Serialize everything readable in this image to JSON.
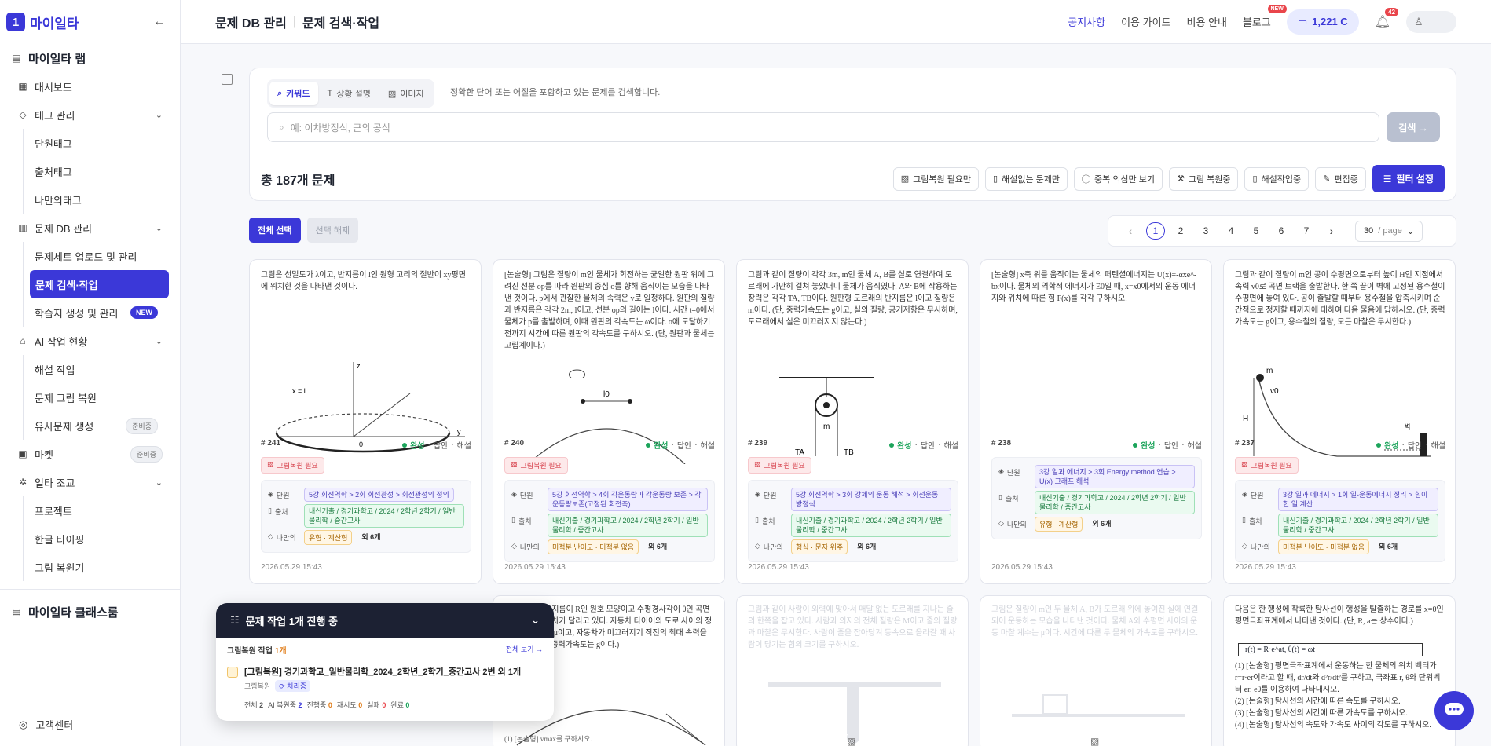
{
  "brand": {
    "logo_text": "마이일타"
  },
  "sidebar": {
    "app_section": "마이일타 랩",
    "items": [
      {
        "label": "대시보드"
      },
      {
        "label": "태그 관리"
      },
      {
        "label": "문제 DB 관리"
      },
      {
        "label": "AI 작업 현황"
      },
      {
        "label": "마켓",
        "badge": "준비중"
      },
      {
        "label": "일타 조교"
      }
    ],
    "tag_sub": [
      "단원태그",
      "출처태그",
      "나만의태그"
    ],
    "db_sub": [
      "문제세트 업로드 및 관리",
      "문제 검색·작업",
      "학습지 생성 및 관리"
    ],
    "db_sub_badge": "NEW",
    "ai_sub": [
      "해설 작업",
      "문제 그림 복원",
      "유사문제 생성"
    ],
    "ai_sub_badge": "준비중",
    "tutor_sub": [
      "프로젝트",
      "한글 타이핑",
      "그림 복원기"
    ],
    "classroom": "마이일타 클래스룸",
    "support": "고객센터"
  },
  "header": {
    "crumb1": "문제 DB 관리",
    "crumb2": "문제 검색·작업",
    "nav": [
      "공지사항",
      "이용 가이드",
      "비용 안내",
      "블로그"
    ],
    "blog_badge": "NEW",
    "credit": "1,221 C",
    "notif_count": "42"
  },
  "search": {
    "tabs": [
      "키워드",
      "상황 설명",
      "이미지"
    ],
    "help": "정확한 단어 또는 어절을 포함하고 있는 문제를 검색합니다.",
    "placeholder": "예: 이차방정식, 근의 공식",
    "button": "검색 →"
  },
  "filters": {
    "total": "총 187개 문제",
    "chips": [
      "그림복원 필요만",
      "해설없는 문제만",
      "중복 의심만 보기",
      "그림 복원중",
      "해설작업중",
      "편집중"
    ],
    "filter_button": "필터 설정"
  },
  "selection": {
    "select_all": "전체 선택",
    "clear": "선택 해제"
  },
  "pager": {
    "pages": [
      "1",
      "2",
      "3",
      "4",
      "5",
      "6",
      "7"
    ],
    "current": "1",
    "per_page": "30",
    "per_page_unit": "/ page"
  },
  "cards": [
    {
      "text": "그림은 선밀도가 λ이고, 반지름이 l인 원형 고리의 절반이 xy평면에 위치한 것을 나타낸 것이다.",
      "num": "# 241",
      "status": "완성",
      "answer": "답안",
      "solution": "해설",
      "flag": "그림복원 필요",
      "unit": "5강 회전역학 > 2회 회전관성 > 회전관성의 정의",
      "source": "내신기출 / 경기과학고 / 2024 / 2학년 2학기 / 일반물리학 / 중간고사",
      "mine": [
        "유형 · 계산형"
      ],
      "more": "외 6개",
      "date": "2026.05.29 15:43"
    },
    {
      "text": "[논술형] 그림은 질량이 m인 물체가 회전하는 균일한 원판 위에 그려진 선분 op를 따라 원판의 중심 o를 향해 움직이는 모습을 나타낸 것이다. p에서 관찰한 물체의 속력은 v로 일정하다. 원판의 질량과 반지름은 각각 2m, l이고, 선분 op의 길이는 l이다. 시간 t=0에서 물체가 p를 출발하며, 이때 원판의 각속도는 ω이다. o에 도달하기 전까지 시간에 따른 원판의 각속도를 구하시오. (단, 원판과 물체는 고립계이다.)",
      "num": "# 240",
      "status": "완성",
      "answer": "답안",
      "solution": "해설",
      "flag": "그림복원 필요",
      "unit": "5강 회전역학 > 4회 각운동량과 각운동량 보존 > 각운동량보존(고정된 회전축)",
      "source": "내신기출 / 경기과학고 / 2024 / 2학년 2학기 / 일반물리학 / 중간고사",
      "mine": [
        "미적분 난이도 · 미적분 없음"
      ],
      "more": "외 6개",
      "date": "2026.05.29 15:43"
    },
    {
      "text": "그림과 같이 질량이 각각 3m, m인 물체 A, B를 실로 연결하여 도르래에 가만히 걸쳐 놓았더니 물체가 움직였다. A와 B에 작용하는 장력은 각각 TA, TB이다. 원판형 도르래의 반지름은 l이고 질량은 m이다. (단, 중력가속도는 g이고, 실의 질량, 공기저항은 무시하며, 도르래에서 실은 미끄러지지 않는다.)",
      "num": "# 239",
      "status": "완성",
      "answer": "답안",
      "solution": "해설",
      "flag": "그림복원 필요",
      "unit": "5강 회전역학 > 3회 강체의 운동 해석 > 회전운동 방정식",
      "source": "내신기출 / 경기과학고 / 2024 / 2학년 2학기 / 일반물리학 / 중간고사",
      "mine": [
        "형식 · 문자 위주"
      ],
      "more": "외 6개",
      "date": "2026.05.29 15:43"
    },
    {
      "text": "[논술형] x축 위를 움직이는 물체의 퍼텐셜에너지는 U(x)=-αxe^-bx이다. 물체의 역학적 에너지가 E0일 때, x=x0에서의 운동 에너지와 위치에 따른 힘 F(x)를 각각 구하시오.",
      "num": "# 238",
      "status": "완성",
      "answer": "답안",
      "solution": "해설",
      "flag": "",
      "unit": "3강 일과 에너지 > 3회 Energy method 연습 > U(x) 그래프 해석",
      "source": "내신기출 / 경기과학고 / 2024 / 2학년 2학기 / 일반물리학 / 중간고사",
      "mine": [
        "유형 · 계산형"
      ],
      "more": "외 6개",
      "date": "2026.05.29 15:43"
    },
    {
      "text": "그림과 같이 질량이 m인 공이 수평면으로부터 높이 H인 지점에서 속력 v0로 곡면 트랙을 출발한다. 한 쪽 끝이 벽에 고정된 용수철이 수평면에 놓여 있다. 공이 출발할 때부터 용수철을 압축시키며 순간적으로 정지할 때까지에 대하여 다음 물음에 답하시오. (단, 중력가속도는 g이고, 용수철의 질량, 모든 마찰은 무시한다.)",
      "num": "# 237",
      "status": "완성",
      "answer": "답안",
      "solution": "해설",
      "flag": "그림복원 필요",
      "unit": "3강 일과 에너지 > 1회 일-운동에너지 정리 > 힘이 한 일 계산",
      "source": "내신기출 / 경기과학고 / 2024 / 2학년 2학기 / 일반물리학 / 중간고사",
      "mine": [
        "미적분 난이도 · 미적분 없음"
      ],
      "more": "외 6개",
      "date": "2026.05.29 15:43"
    }
  ],
  "row2": [
    {
      "text": "그림과 같이 반지름이 R인 원호 모양이고 수평경사각이 θ인 곡면 트랙 위를 자동차가 달리고 있다. 자동차 타이어와 도로 사이의 정지 마찰 계수는 μ이고, 자동차가 미끄러지기 직전의 최대 속력을 구하시오. (단, 중력가속도는 g이다.)",
      "answer_line": "(1) [논술형] vmax를 구하시오."
    },
    {
      "text": "그림과 같이 사람이 외력에 맞아서 매달 없는 도르래를 지나는 줄의 한쪽을 잡고 있다. 사람과 의자의 전체 질량은 M이고 줄의 질량과 마찰은 무시한다. 사람이 줄을 잡아당겨 등속으로 올라갈 때 사람이 당기는 힘의 크기를 구하시오."
    },
    {
      "text": "그림은 질량이 m인 두 물체 A, B가 도르래 위에 놓여진 실에 연결되어 운동하는 모습을 나타낸 것이다. 물체 A와 수평면 사이의 운동 마찰 계수는 μ이다. 시간에 따른 두 물체의 가속도를 구하시오."
    },
    {
      "text": "다음은 한 행성에 착륙한 탐사선이 행성을 탈출하는 경로를 x=0인 평면극좌표계에서 나타낸 것이다. (단, R, a는 상수이다.)",
      "formula": "r(t) = R·e^at,    θ(t) = ωt",
      "lines": [
        "(1) [논술형] 평면극좌표계에서 운동하는 한 물체의 위치 벡터가 r=r·er이라고 할 때, dr/dt와 d²r/dt²를 구하고, 극좌표 r, θ와 단위벡터 er, eθ를 이용하여 나타내시오.",
        "(2) [논술형] 탐사선의 시간에 따른 속도를 구하시오.",
        "(3) [논술형] 탐사선의 시간에 따른 가속도를 구하시오.",
        "(4) [논술형] 탐사선의 속도와 가속도 사이의 각도를 구하시오."
      ]
    }
  ],
  "card_labels": {
    "unit": "단원",
    "source": "출처",
    "mine": "나만의"
  },
  "job": {
    "title": "문제 작업 1개 진행 중",
    "group": "그림복원 작업",
    "group_count": "1개",
    "view_all": "전체 보기 →",
    "item_title": "[그림복원] 경기과학고_일반물리학_2024_2학년_2학기_중간고사 2번 외 1개",
    "item_type": "그림복원",
    "item_status": "처리중",
    "stats": [
      {
        "label": "전체",
        "value": "2"
      },
      {
        "label": "AI 복원중",
        "value": "2"
      },
      {
        "label": "진행중",
        "value": "0"
      },
      {
        "label": "재시도",
        "value": "0"
      },
      {
        "label": "실패",
        "value": "0"
      },
      {
        "label": "완료",
        "value": "0"
      }
    ]
  },
  "colors": {
    "primary": "#3b38d8",
    "success": "#1ca45b",
    "danger": "#e9454b",
    "dark": "#1c2133"
  }
}
